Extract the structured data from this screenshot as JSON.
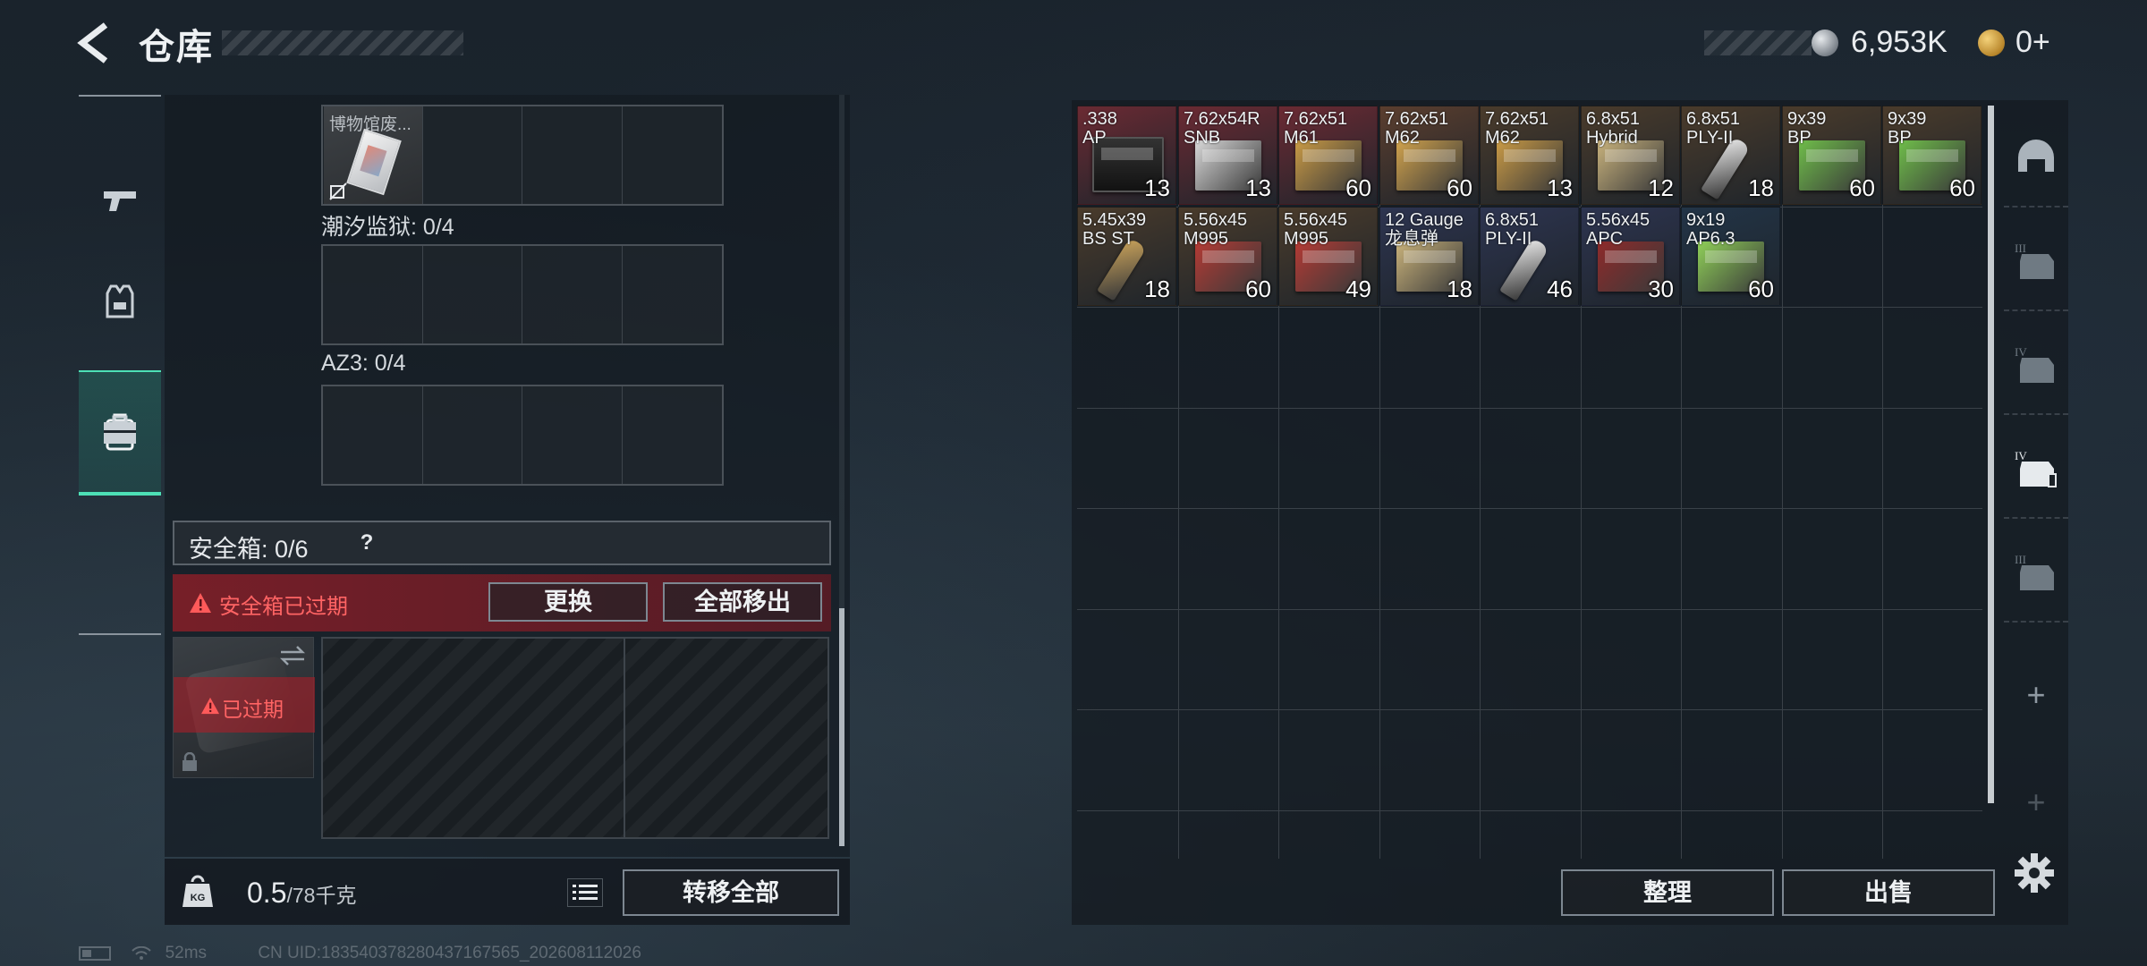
{
  "header": {
    "title": "仓库",
    "silver_amount": "6,953K",
    "gold_amount": "0+"
  },
  "sidebar": {
    "tabs": [
      {
        "name": "weapon",
        "icon": "pistol-icon",
        "active": false
      },
      {
        "name": "gear",
        "icon": "vest-icon",
        "active": false
      },
      {
        "name": "backpack",
        "icon": "backpack-icon",
        "active": true
      },
      {
        "name": "case",
        "icon": "toolbox-icon",
        "active": false
      }
    ]
  },
  "loadout": {
    "museum_item_name": "博物馆废...",
    "tidal_prison_label": "潮汐监狱: 0/4",
    "az3_label": "AZ3: 0/4"
  },
  "safe_box": {
    "title": "安全箱: 0/6",
    "help": "?",
    "expired_message": "安全箱已过期",
    "replace_label": "更换",
    "move_all_out_label": "全部移出",
    "case_expired_label": "已过期"
  },
  "weight": {
    "current": "0.5",
    "max": "/78千克",
    "kg_icon_text": "KG",
    "transfer_all_label": "转移全部"
  },
  "status_bar": {
    "ping": "52ms",
    "uid": "CN UID:183540378280437167565_202608112026"
  },
  "stash": {
    "items": [
      {
        "name": ".338\nAP",
        "count": "13",
        "bg": "#6b2a33",
        "box": "can",
        "box_color": "#1d1d1d"
      },
      {
        "name": "7.62x54R\nSNB",
        "count": "13",
        "bg": "#6b2a33",
        "box": "box",
        "box_color": "#d8d8d8"
      },
      {
        "name": "7.62x51\nM61",
        "count": "60",
        "bg": "#6b2a33",
        "box": "box",
        "box_color": "#c99a45"
      },
      {
        "name": "7.62x51\nM62",
        "count": "60",
        "bg": "#5b3e2e",
        "box": "box",
        "box_color": "#d0a24c"
      },
      {
        "name": "7.62x51\nM62",
        "count": "13",
        "bg": "#4a3b2b",
        "box": "box",
        "box_color": "#c99a45"
      },
      {
        "name": "6.8x51\nHybrid",
        "count": "12",
        "bg": "#4a3b2b",
        "box": "box",
        "box_color": "#c8b27c"
      },
      {
        "name": "6.8x51\nPLY-II",
        "count": "18",
        "bg": "#4a3b2b",
        "box": "round",
        "box_color": "#e8e8e8"
      },
      {
        "name": "9x39\nBP",
        "count": "60",
        "bg": "#4a3b2b",
        "box": "box",
        "box_color": "#6fbd4a"
      },
      {
        "name": "9x39\nBP",
        "count": "60",
        "bg": "#4a3b2b",
        "box": "box",
        "box_color": "#6fbd4a"
      },
      {
        "name": "5.45x39\nBS ST",
        "count": "18",
        "bg": "#4a3b2b",
        "box": "round",
        "box_color": "#c9a25a"
      },
      {
        "name": "5.56x45\nM995",
        "count": "60",
        "bg": "#4a3b2b",
        "box": "box",
        "box_color": "#b43a34"
      },
      {
        "name": "5.56x45\nM995",
        "count": "49",
        "bg": "#4a3b2b",
        "box": "box",
        "box_color": "#b43a34"
      },
      {
        "name": "12 Gauge\n龙息弹",
        "count": "18",
        "bg": "#2d3450",
        "box": "box",
        "box_color": "#c9b27a"
      },
      {
        "name": "6.8x51\nPLY-II",
        "count": "46",
        "bg": "#2d3450",
        "box": "round",
        "box_color": "#e8e8e8"
      },
      {
        "name": "5.56x45\nAPC",
        "count": "30",
        "bg": "#2d3450",
        "box": "box",
        "box_color": "#8e2a2a"
      },
      {
        "name": "9x19\nAP6.3",
        "count": "60",
        "bg": "#223447",
        "box": "box",
        "box_color": "#8fcf58"
      }
    ]
  },
  "side_rail": {
    "items": [
      "helmet-icon",
      "armor-iii-icon",
      "armor-iv-icon",
      "rig-iv-icon",
      "armor-iii-icon"
    ]
  },
  "actions": {
    "sort_label": "整理",
    "sell_label": "出售"
  }
}
